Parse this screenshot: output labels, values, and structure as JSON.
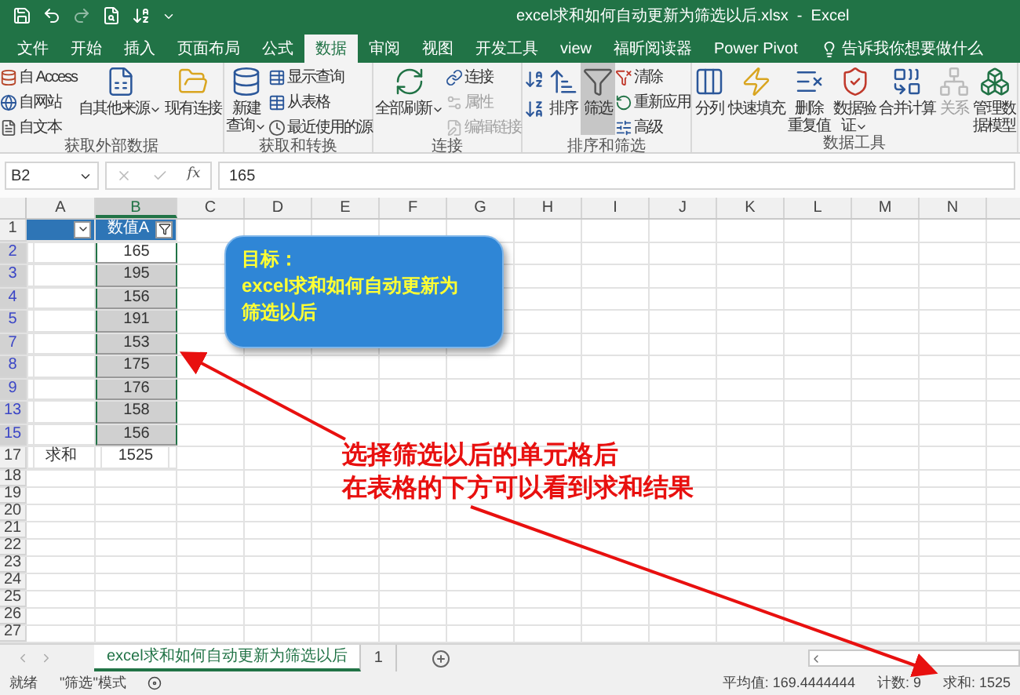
{
  "window": {
    "title": "excel求和如何自动更新为筛选以后.xlsx  -  Excel"
  },
  "tabs": [
    {
      "label": "文件",
      "selected": false
    },
    {
      "label": "开始",
      "selected": false
    },
    {
      "label": "插入",
      "selected": false
    },
    {
      "label": "页面布局",
      "selected": false
    },
    {
      "label": "公式",
      "selected": false
    },
    {
      "label": "数据",
      "selected": true
    },
    {
      "label": "审阅",
      "selected": false
    },
    {
      "label": "视图",
      "selected": false
    },
    {
      "label": "开发工具",
      "selected": false
    },
    {
      "label": "view",
      "selected": false
    },
    {
      "label": "福昕阅读器",
      "selected": false
    },
    {
      "label": "Power Pivot",
      "selected": false
    }
  ],
  "tell_me": "告诉我你想要做什么",
  "ribbon_groups": [
    {
      "label": "获取外部数据",
      "commands": [
        {
          "kind": "stack",
          "items": [
            {
              "label": "自 Access",
              "disabled": false
            },
            {
              "label": "自网站",
              "disabled": false
            },
            {
              "label": "自文本",
              "disabled": false
            }
          ]
        },
        {
          "kind": "large",
          "lines": [
            "自其他来源"
          ],
          "menu": true,
          "disabled": false,
          "pressed": false
        },
        {
          "kind": "large",
          "lines": [
            "现有连接"
          ],
          "menu": false,
          "disabled": false,
          "pressed": false
        }
      ]
    },
    {
      "label": "获取和转换",
      "commands": [
        {
          "kind": "large",
          "lines": [
            "新建",
            "查询"
          ],
          "menu": true,
          "disabled": false,
          "pressed": false
        },
        {
          "kind": "stack",
          "items": [
            {
              "label": "显示查询",
              "disabled": false
            },
            {
              "label": "从表格",
              "disabled": false
            },
            {
              "label": "最近使用的源",
              "disabled": false
            }
          ]
        }
      ]
    },
    {
      "label": "连接",
      "commands": [
        {
          "kind": "large",
          "lines": [
            "全部刷新"
          ],
          "menu": true,
          "disabled": false,
          "pressed": false
        },
        {
          "kind": "stack",
          "items": [
            {
              "label": "连接",
              "disabled": false
            },
            {
              "label": "属性",
              "disabled": true
            },
            {
              "label": "编辑链接",
              "disabled": true
            }
          ]
        }
      ]
    },
    {
      "label": "排序和筛选",
      "commands": [
        {
          "kind": "sort"
        },
        {
          "kind": "large",
          "lines": [
            "排序"
          ],
          "menu": false,
          "disabled": false,
          "pressed": false
        },
        {
          "kind": "large",
          "lines": [
            "筛选"
          ],
          "menu": false,
          "disabled": false,
          "pressed": true
        },
        {
          "kind": "stack",
          "items": [
            {
              "label": "清除",
              "disabled": false
            },
            {
              "label": "重新应用",
              "disabled": false
            },
            {
              "label": "高级",
              "disabled": false
            }
          ]
        }
      ]
    },
    {
      "label": "数据工具",
      "commands": [
        {
          "kind": "large",
          "lines": [
            "分列"
          ],
          "menu": false,
          "disabled": false,
          "pressed": false
        },
        {
          "kind": "large",
          "lines": [
            "快速填充"
          ],
          "menu": false,
          "disabled": false,
          "pressed": false
        },
        {
          "kind": "large",
          "lines": [
            "删除",
            "重复值"
          ],
          "menu": false,
          "disabled": false,
          "pressed": false
        },
        {
          "kind": "large",
          "lines": [
            "数据验",
            "证"
          ],
          "menu": true,
          "disabled": false,
          "pressed": false
        },
        {
          "kind": "large",
          "lines": [
            "合并计算"
          ],
          "menu": false,
          "disabled": false,
          "pressed": false
        },
        {
          "kind": "large",
          "lines": [
            "关系"
          ],
          "menu": false,
          "disabled": true,
          "pressed": false
        },
        {
          "kind": "large",
          "lines": [
            "管理数",
            "据模型"
          ],
          "menu": false,
          "disabled": false,
          "pressed": false
        }
      ]
    }
  ],
  "formula_bar": {
    "name_box": "B2",
    "function_label": "fx",
    "formula": "165"
  },
  "columns": [
    {
      "label": "A",
      "selected": false
    },
    {
      "label": "B",
      "selected": true
    },
    {
      "label": "C",
      "selected": false
    },
    {
      "label": "D",
      "selected": false
    },
    {
      "label": "E",
      "selected": false
    },
    {
      "label": "F",
      "selected": false
    },
    {
      "label": "G",
      "selected": false
    },
    {
      "label": "H",
      "selected": false
    },
    {
      "label": "I",
      "selected": false
    },
    {
      "label": "J",
      "selected": false
    },
    {
      "label": "K",
      "selected": false
    },
    {
      "label": "L",
      "selected": false
    },
    {
      "label": "M",
      "selected": false
    },
    {
      "label": "N",
      "selected": false
    }
  ],
  "rows": [
    {
      "number": "1",
      "kind": "header",
      "selected": false,
      "filtered": false,
      "header_cells": [
        {
          "kind": "dropdown"
        },
        {
          "text": "数值A",
          "kind": "filtered"
        }
      ]
    },
    {
      "number": "2",
      "kind": "data",
      "selected": true,
      "filtered": true,
      "value": "165",
      "active": true
    },
    {
      "number": "3",
      "kind": "data",
      "selected": true,
      "filtered": true,
      "value": "195",
      "active": false
    },
    {
      "number": "4",
      "kind": "data",
      "selected": true,
      "filtered": true,
      "value": "156",
      "active": false
    },
    {
      "number": "5",
      "kind": "data",
      "selected": true,
      "filtered": true,
      "value": "191",
      "active": false
    },
    {
      "number": "7",
      "kind": "data",
      "selected": true,
      "filtered": true,
      "value": "153",
      "active": false
    },
    {
      "number": "8",
      "kind": "data",
      "selected": true,
      "filtered": true,
      "value": "175",
      "active": false
    },
    {
      "number": "9",
      "kind": "data",
      "selected": true,
      "filtered": true,
      "value": "176",
      "active": false
    },
    {
      "number": "13",
      "kind": "data",
      "selected": true,
      "filtered": true,
      "value": "158",
      "active": false
    },
    {
      "number": "15",
      "kind": "data",
      "selected": true,
      "filtered": true,
      "value": "156",
      "active": false
    },
    {
      "number": "17",
      "kind": "total",
      "selected": false,
      "filtered": false,
      "label": "求和",
      "value": "1525"
    },
    {
      "number": "18",
      "kind": "blank",
      "selected": false,
      "filtered": false
    },
    {
      "number": "19",
      "kind": "blank",
      "selected": false,
      "filtered": false
    },
    {
      "number": "20",
      "kind": "blank",
      "selected": false,
      "filtered": false
    },
    {
      "number": "21",
      "kind": "blank",
      "selected": false,
      "filtered": false
    },
    {
      "number": "22",
      "kind": "blank",
      "selected": false,
      "filtered": false
    },
    {
      "number": "23",
      "kind": "blank",
      "selected": false,
      "filtered": false
    },
    {
      "number": "24",
      "kind": "blank",
      "selected": false,
      "filtered": false
    },
    {
      "number": "25",
      "kind": "blank",
      "selected": false,
      "filtered": false
    },
    {
      "number": "26",
      "kind": "blank",
      "selected": false,
      "filtered": false
    },
    {
      "number": "27",
      "kind": "blank",
      "selected": false,
      "filtered": false
    }
  ],
  "callout": {
    "lines": [
      "目标：",
      "excel求和如何自动更新为",
      "筛选以后"
    ]
  },
  "annotation": {
    "lines": [
      "选择筛选以后的单元格后",
      "在表格的下方可以看到求和结果"
    ]
  },
  "sheet_tabs": [
    {
      "label": "excel求和如何自动更新为筛选以后",
      "selected": true
    },
    {
      "label": "1",
      "selected": false
    }
  ],
  "status_bar": {
    "mode": "就绪",
    "filter_mode": "\"筛选\"模式",
    "average": "平均值: 169.4444444",
    "count": "计数: 9",
    "sum": "求和: 1525"
  }
}
